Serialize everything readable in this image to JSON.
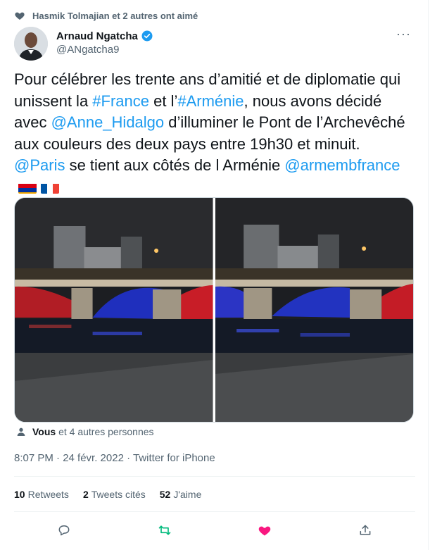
{
  "social_context": "Hasmik Tolmajian et 2 autres ont aimé",
  "author": {
    "display_name": "Arnaud Ngatcha",
    "handle": "@ANgatcha9"
  },
  "tweet": {
    "t1": "Pour célébrer les trente ans d’amitié et de diplomatie qui unissent la ",
    "tag_france": "#France",
    "t2": " et l’",
    "tag_armenie": "#Arménie",
    "t3": ", nous avons décidé avec ",
    "mention_hidalgo": "@Anne_Hidalgo",
    "t4": " d’illuminer le Pont de l’Archevêché aux couleurs des deux pays entre 19h30 et minuit. ",
    "mention_paris": "@Paris",
    "t5": " se tient aux côtés de l Arménie ",
    "mention_armemb": "@armembfrance"
  },
  "likers": {
    "bold": "Vous",
    "rest": "et 4 autres personnes"
  },
  "meta": "8:07 PM · 24 févr. 2022 · Twitter for iPhone",
  "stats": {
    "retweets_count": "10",
    "retweets_label": "Retweets",
    "quotes_count": "2",
    "quotes_label": "Tweets cités",
    "likes_count": "52",
    "likes_label": "J'aime"
  },
  "colors": {
    "link": "#1d9bf0",
    "retweet": "#00ba7c",
    "like": "#f91880",
    "verified": "#1d9bf0"
  },
  "icons": [
    "heart-icon",
    "verified-badge-icon",
    "more-icon",
    "person-icon",
    "reply-icon",
    "retweet-icon",
    "like-icon",
    "share-icon"
  ]
}
